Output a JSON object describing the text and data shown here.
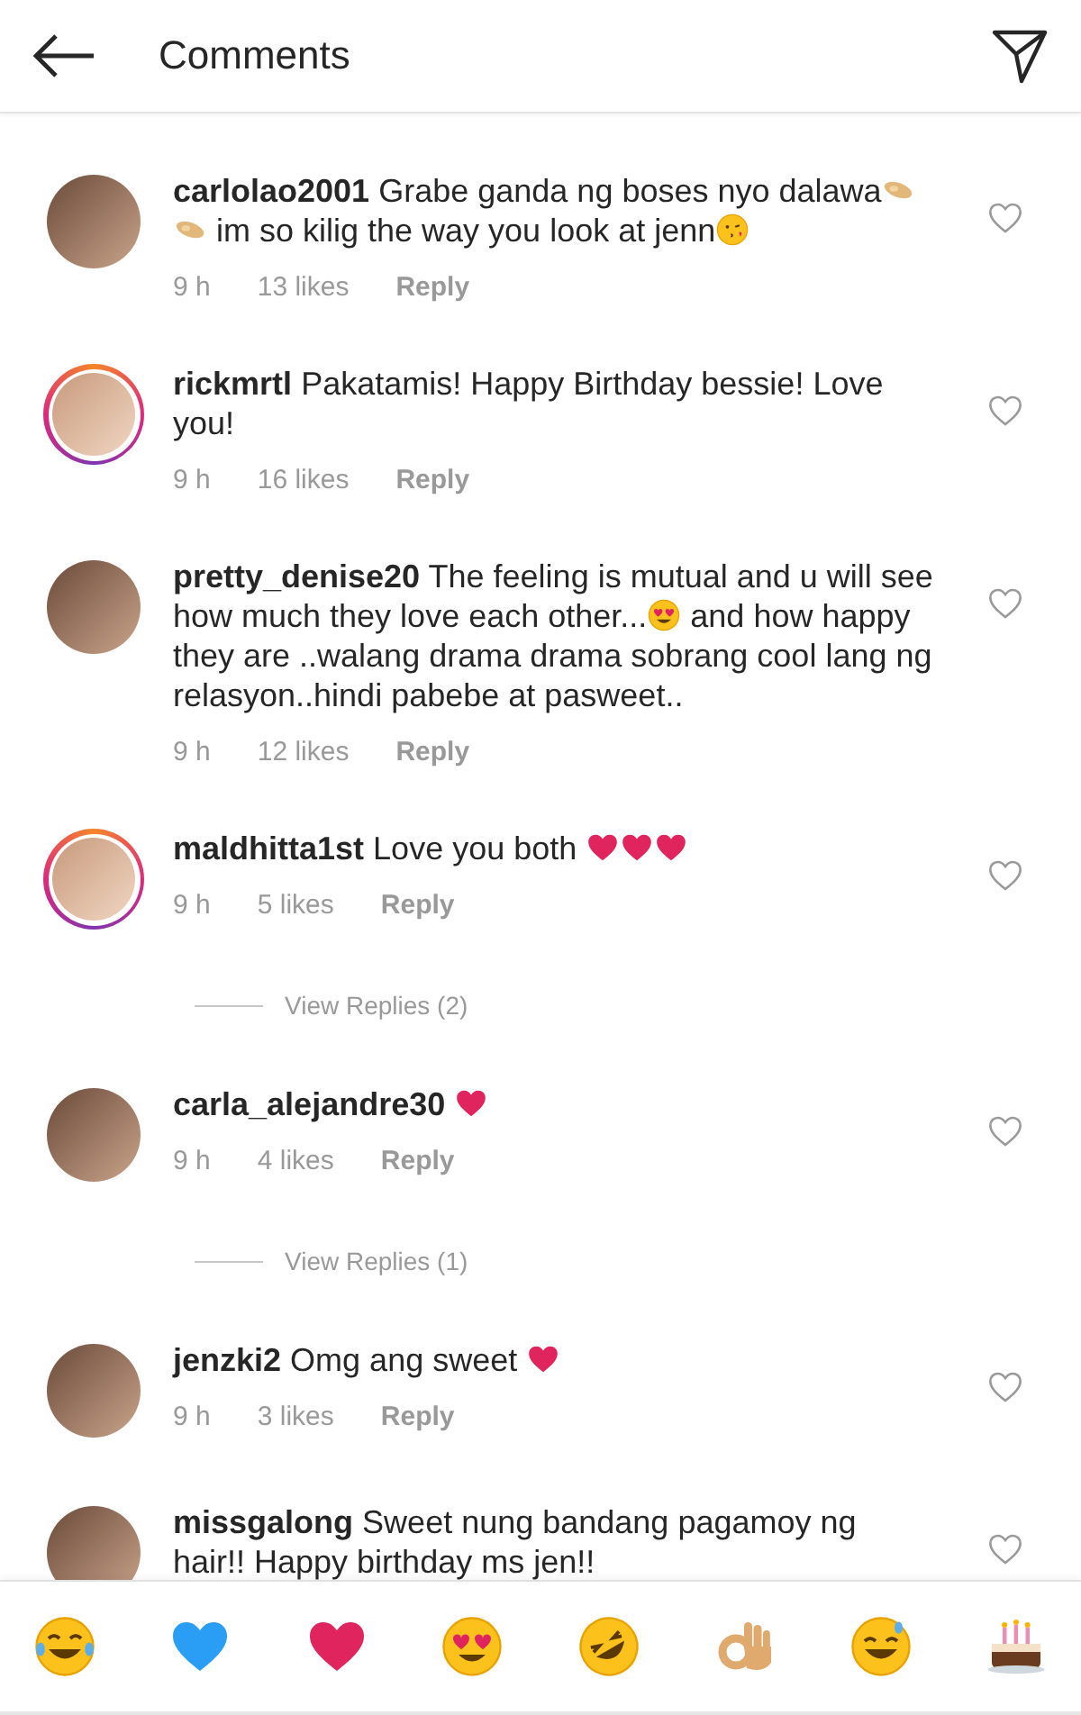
{
  "header": {
    "title": "Comments"
  },
  "items": [
    {
      "kind": "comment",
      "username": "carlolao2001",
      "story_ring": false,
      "parts": [
        {
          "kind": "text",
          "text": "Grabe ganda ng boses nyo dalawa"
        },
        {
          "kind": "peanut"
        },
        {
          "kind": "peanut"
        },
        {
          "kind": "text",
          "text": " im so kilig the way you look at jenn"
        },
        {
          "kind": "kiss"
        }
      ],
      "time": "9 h",
      "likes": "13 likes",
      "reply": "Reply"
    },
    {
      "kind": "comment",
      "username": "rickmrtl",
      "story_ring": true,
      "parts": [
        {
          "kind": "text",
          "text": "Pakatamis! Happy Birthday bessie! Love you!"
        }
      ],
      "time": "9 h",
      "likes": "16 likes",
      "reply": "Reply"
    },
    {
      "kind": "comment",
      "username": "pretty_denise20",
      "story_ring": false,
      "parts": [
        {
          "kind": "text",
          "text": "The feeling is mutual and u will see how much they love each other..."
        },
        {
          "kind": "heart_eyes"
        },
        {
          "kind": "text",
          "text": " and how happy they are ..walang drama drama sobrang cool lang ng relasyon..hindi pabebe at pasweet.."
        }
      ],
      "time": "9 h",
      "likes": "12 likes",
      "reply": "Reply"
    },
    {
      "kind": "comment",
      "username": "maldhitta1st",
      "story_ring": true,
      "parts": [
        {
          "kind": "text",
          "text": "Love you both "
        },
        {
          "kind": "red_heart"
        },
        {
          "kind": "red_heart"
        },
        {
          "kind": "red_heart"
        }
      ],
      "time": "9 h",
      "likes": "5 likes",
      "reply": "Reply"
    },
    {
      "kind": "view_replies",
      "label": "View Replies (2)"
    },
    {
      "kind": "comment",
      "username": "carla_alejandre30",
      "story_ring": false,
      "parts": [
        {
          "kind": "red_heart"
        }
      ],
      "time": "9 h",
      "likes": "4 likes",
      "reply": "Reply"
    },
    {
      "kind": "view_replies",
      "label": "View Replies (1)"
    },
    {
      "kind": "comment",
      "username": "jenzki2",
      "story_ring": false,
      "parts": [
        {
          "kind": "text",
          "text": "Omg ang sweet "
        },
        {
          "kind": "red_heart"
        }
      ],
      "time": "9 h",
      "likes": "3 likes",
      "reply": "Reply"
    },
    {
      "kind": "comment",
      "username": "missgalong",
      "story_ring": false,
      "parts": [
        {
          "kind": "text",
          "text": "Sweet nung bandang pagamoy ng hair!! Happy birthday ms jen!!"
        }
      ]
    }
  ],
  "emoji_bar": [
    {
      "kind": "laugh_tears"
    },
    {
      "kind": "blue_heart"
    },
    {
      "kind": "red_heart"
    },
    {
      "kind": "heart_eyes"
    },
    {
      "kind": "rofl"
    },
    {
      "kind": "ok_hand"
    },
    {
      "kind": "sweat_smile"
    },
    {
      "kind": "cake"
    }
  ]
}
